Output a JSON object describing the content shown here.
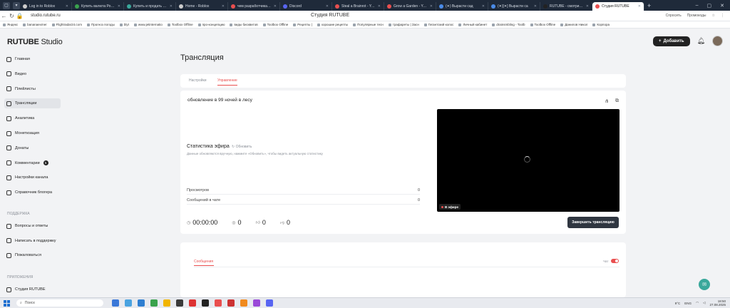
{
  "browser": {
    "tabs": [
      {
        "label": "Log in to Roblox",
        "color": "#cccccc"
      },
      {
        "label": "Купить валюта Роблок",
        "color": "#3aa24d"
      },
      {
        "label": "Купить и продать пло",
        "color": "#3aa89b"
      },
      {
        "label": "Home - Roblox",
        "color": "#cccccc"
      },
      {
        "label": "чем разработчика уз",
        "color": "#e94f4f"
      },
      {
        "label": "Discord",
        "color": "#5865f2"
      },
      {
        "label": "Steal a Brainrot - YouT",
        "color": "#e94f4f"
      },
      {
        "label": "Grow a Garden - YouT",
        "color": "#e94f4f"
      },
      {
        "label": "(✦) Вырасти сад",
        "color": "#4a8be8"
      },
      {
        "label": "(✦)[✦] Вырасти са",
        "color": "#4a8be8"
      },
      {
        "label": "RUTUBE - смотрите о",
        "color": "#222222"
      },
      {
        "label": "Студия RUTUBE",
        "color": "#e94f4f"
      }
    ],
    "active_tab_index": 11,
    "url": "studio.rutube.ru",
    "page_title": "Студия RUTUBE",
    "addr_right": [
      "Спросить",
      "Промокоды"
    ],
    "bookmarks": [
      "Яндекс",
      "bananaexmer",
      "Flightradar24.com",
      "Прогноз погоды",
      "blyt",
      "www.jetinternatio",
      "Toolbox Offline",
      "про-концепцию",
      "виды бисквитов",
      "Toolbox Offline",
      "Рецепты |",
      "хорошие рецепты",
      "Популярные тесн",
      "трафареты | Засн",
      "Гигантский колос",
      "Личный кабинет",
      "drainsmbling - Toolb",
      "Toolbox Offline",
      "Данилов Никол",
      "Корпора"
    ]
  },
  "app": {
    "logo_brand": "RUTUBE",
    "logo_studio": "Studio",
    "nav": [
      {
        "label": "Главная",
        "active": false
      },
      {
        "label": "Видео",
        "active": false
      },
      {
        "label": "Плейлисты",
        "active": false
      },
      {
        "label": "Трансляции",
        "active": true
      },
      {
        "label": "Аналитика",
        "active": false
      },
      {
        "label": "Монетизация",
        "active": false
      },
      {
        "label": "Донаты",
        "active": false
      },
      {
        "label": "Комментарии",
        "active": false,
        "badge": "5"
      },
      {
        "label": "Настройки канала",
        "active": false
      },
      {
        "label": "Справочник блогера",
        "active": false
      }
    ],
    "support_title": "ПОДДЕРЖКА",
    "support": [
      "Вопросы и ответы",
      "Написать в поддержку",
      "Пожаловаться"
    ],
    "apps_title": "ПРИЛОЖЕНИЯ",
    "apps": [
      "Студия RUTUBE"
    ],
    "add_button": "Добавить",
    "page_heading": "Трансляция",
    "subtabs": [
      "Настройки",
      "Управление"
    ],
    "active_subtab": 1,
    "stream": {
      "title": "обновление в 99 ночей в лесу",
      "stats_title": "Статистика эфира",
      "refresh": "Обновить",
      "stats_note": "Данные обновляются вручную, нажмите «Обновить», чтобы видеть актуальную статистику",
      "rows": [
        {
          "label": "Просмотров",
          "value": "0"
        },
        {
          "label": "Сообщений в чате",
          "value": "0"
        }
      ],
      "live_label": "В эфире",
      "duration": "00:00:00",
      "viewers": "0",
      "likes": "0",
      "dislikes": "0",
      "end_button": "Завершить трансляцию"
    },
    "chat": {
      "tab": "Сообщения",
      "toggle_label": "Чат",
      "enabled": true
    }
  },
  "taskbar": {
    "search_placeholder": "Поиск",
    "lang": "ENG",
    "temp": "9°C",
    "time": "18:50",
    "date": "27.08.2025",
    "apps": [
      "#3a78d8",
      "#4aa3e0",
      "#2f7fd1",
      "#3aa24d",
      "#f1b500",
      "#3a3a3a",
      "#d33",
      "#222222",
      "#e94f4f",
      "#c33",
      "#f08a1f",
      "#9a4ad8",
      "#5865f2"
    ]
  }
}
